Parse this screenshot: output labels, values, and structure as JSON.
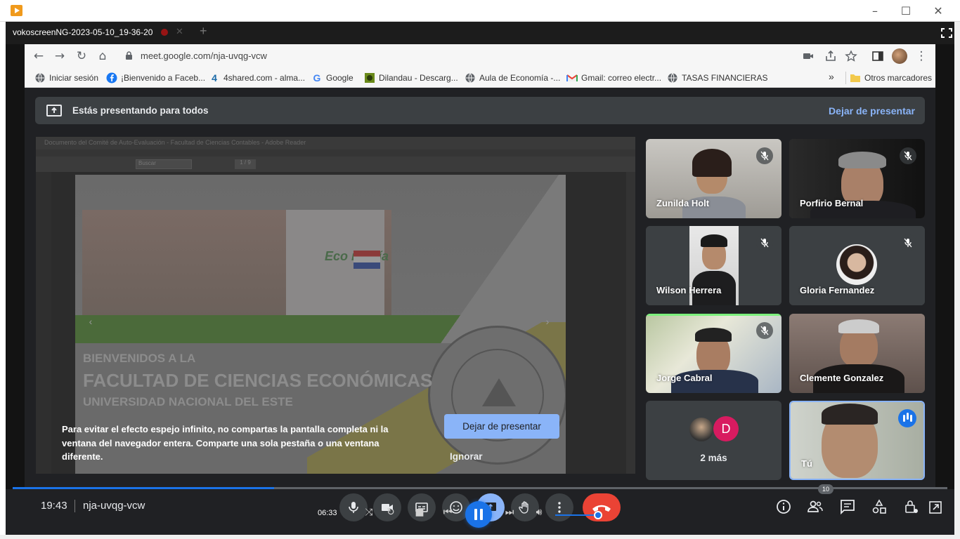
{
  "player": {
    "window_title": "vokoscreenNG-2023-05-10_19-36-20",
    "elapsed": "06:33",
    "progress_fraction": 0.28,
    "volume_fraction": 0.93
  },
  "browser": {
    "url": "meet.google.com/nja-uvqg-vcw",
    "bookmarks": [
      {
        "label": "Iniciar sesión",
        "icon": "globe-icon"
      },
      {
        "label": "¡Bienvenido a Faceb...",
        "icon": "facebook-icon"
      },
      {
        "label": "4shared.com - alma...",
        "icon": "4shared-icon"
      },
      {
        "label": "Google",
        "icon": "google-icon"
      },
      {
        "label": "Dilandau - Descarg...",
        "icon": "dilandau-icon"
      },
      {
        "label": "Aula de Economía -...",
        "icon": "globe-icon"
      },
      {
        "label": "Gmail: correo electr...",
        "icon": "gmail-icon"
      },
      {
        "label": "TASAS FINANCIERAS",
        "icon": "globe-icon"
      }
    ],
    "bookmarks_overflow": "»",
    "other_bookmarks": "Otros marcadores"
  },
  "meet": {
    "banner_text": "Estás presentando para todos",
    "stop_presenting": "Dejar de presentar",
    "warning_text": "Para evitar el efecto espejo infinito, no compartas la pantalla completa ni la ventana del navegador entera. Comparte una sola pestaña o una ventana diferente.",
    "warning_stop_button": "Dejar de presentar",
    "warning_ignore": "Ignorar",
    "shared_screen": {
      "window_title": "Documento del Comité de Auto-Evaluación - Facultad de Ciencias Contables - Adobe Reader",
      "search_placeholder": "Buscar",
      "page_indicator": "1 / 9",
      "slide_line1": "BIENVENIDOS A LA",
      "slide_line2": "FACULTAD DE CIENCIAS ECONÓMICAS",
      "slide_line3": "UNIVERSIDAD NACIONAL DEL ESTE",
      "slide_logo_text": "Eco nomía"
    },
    "participants": [
      {
        "name": "Zunilda Holt",
        "muted": true
      },
      {
        "name": "Porfirio Bernal",
        "muted": true
      },
      {
        "name": "Wilson Herrera",
        "muted": true
      },
      {
        "name": "Gloria Fernandez",
        "muted": true
      },
      {
        "name": "Jorge Cabral",
        "muted": true
      },
      {
        "name": "Clemente Gonzalez",
        "muted": false
      },
      {
        "name": "Tú",
        "muted": false,
        "speaking": true
      }
    ],
    "more": {
      "avatar_letter": "D",
      "label": "2 más"
    },
    "time": "19:43",
    "meeting_code": "nja-uvqg-vcw",
    "people_count": "10"
  },
  "colors": {
    "accent": "#8ab4f8",
    "meet_bg": "#202124",
    "tile_bg": "#3c4043",
    "hangup": "#ea4335",
    "primary_blue": "#1a73e8"
  }
}
